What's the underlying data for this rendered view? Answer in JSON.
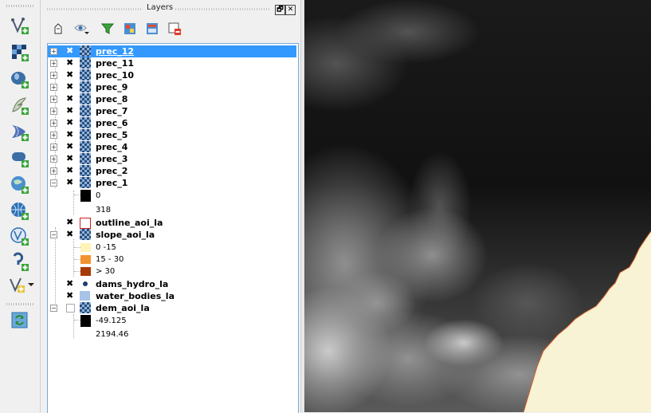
{
  "panel": {
    "title": "Layers",
    "float_label": "🗗",
    "close_label": "✕"
  },
  "layers": [
    {
      "name": "prec_12",
      "selected": true
    },
    {
      "name": "prec_11"
    },
    {
      "name": "prec_10"
    },
    {
      "name": "prec_9"
    },
    {
      "name": "prec_8"
    },
    {
      "name": "prec_7"
    },
    {
      "name": "prec_6"
    },
    {
      "name": "prec_5"
    },
    {
      "name": "prec_4"
    },
    {
      "name": "prec_3"
    },
    {
      "name": "prec_2"
    },
    {
      "name": "prec_1"
    },
    {
      "name": "outline_aoi_la"
    },
    {
      "name": "slope_aoi_la"
    },
    {
      "name": "dams_hydro_la"
    },
    {
      "name": "water_bodies_la"
    },
    {
      "name": "dem_aoi_la"
    }
  ],
  "legends": {
    "prec_1": {
      "min": "0",
      "max": "318"
    },
    "slope": [
      "0 -15",
      "15 - 30",
      "> 30"
    ],
    "dem": {
      "min": "-49.125",
      "max": "2194.46"
    }
  },
  "colors": {
    "selection": "#3399ff",
    "slope_low": "#fff3b8",
    "slope_mid": "#f39330",
    "slope_high": "#a83a05",
    "water": "#a7c3e8",
    "land": "#f7f3d4"
  },
  "icons": {
    "toolbar": [
      "add-vector-layer-icon",
      "add-raster-layer-icon",
      "add-postgis-layer-icon",
      "add-spatialite-layer-icon",
      "add-mssql-layer-icon",
      "add-oracle-layer-icon",
      "add-wms-layer-icon",
      "add-wcs-layer-icon",
      "add-wfs-layer-icon",
      "add-delimited-text-icon",
      "new-vector-layer-icon",
      "refresh-icon"
    ]
  }
}
